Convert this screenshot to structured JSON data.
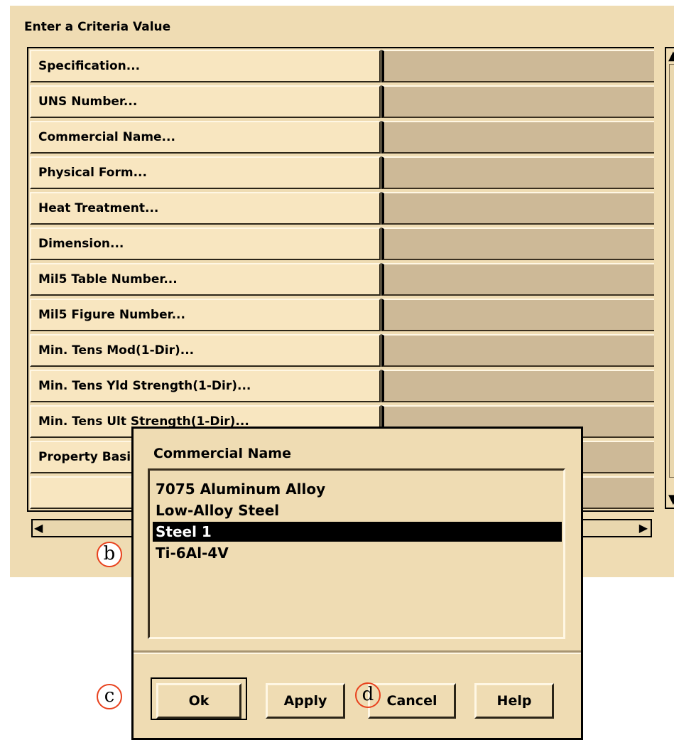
{
  "criteria_panel": {
    "title": "Enter a Criteria Value",
    "rows": [
      {
        "label": "Specification..."
      },
      {
        "label": "UNS Number..."
      },
      {
        "label": "Commercial Name..."
      },
      {
        "label": "Physical Form..."
      },
      {
        "label": "Heat Treatment..."
      },
      {
        "label": "Dimension..."
      },
      {
        "label": "Mil5 Table Number..."
      },
      {
        "label": "Mil5 Figure Number..."
      },
      {
        "label": "Min. Tens Mod(1-Dir)..."
      },
      {
        "label": "Min. Tens Yld Strength(1-Dir)..."
      },
      {
        "label": "Min. Tens Ult Strength(1-Dir)..."
      },
      {
        "label": "Property Basis..."
      },
      {
        "label": ""
      }
    ]
  },
  "dialog": {
    "title": "Commercial Name",
    "items": [
      "7075 Aluminum Alloy",
      "Low-Alloy Steel",
      "Steel 1",
      "Ti-6Al-4V"
    ],
    "selected_item": "Steel 1",
    "buttons": {
      "ok": "Ok",
      "apply": "Apply",
      "cancel": "Cancel",
      "help": "Help"
    }
  },
  "callouts": {
    "b": "b",
    "c": "c",
    "d": "d"
  },
  "colors": {
    "panel_bg": "#efdcb3",
    "value_bg": "#cdb997",
    "callout_ring": "#e8411d",
    "selection": "#000000"
  }
}
